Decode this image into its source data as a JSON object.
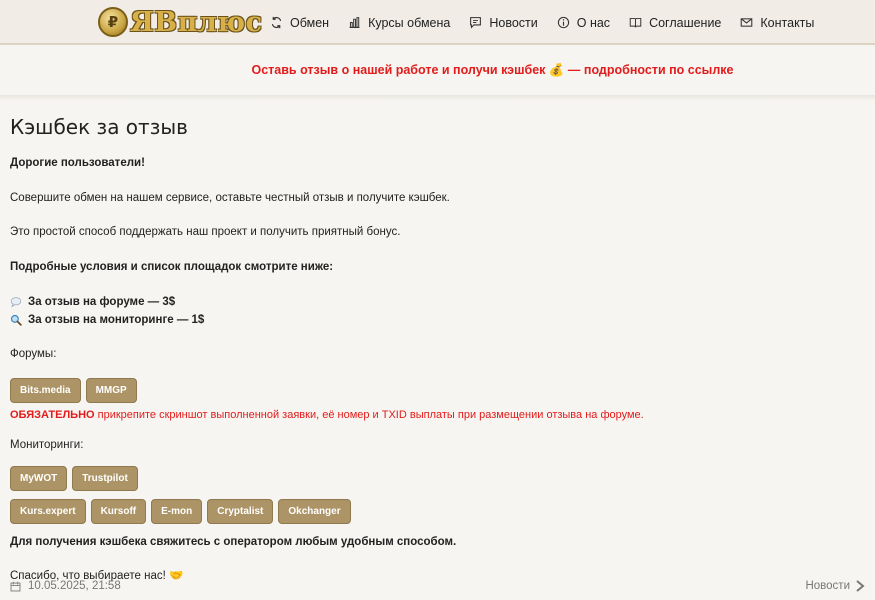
{
  "logo": {
    "text": "ЯВплюс",
    "coin_glyph": "₽"
  },
  "nav": [
    {
      "label": "Обмен",
      "icon": "exchange-icon"
    },
    {
      "label": "Курсы обмена",
      "icon": "chart-icon"
    },
    {
      "label": "Новости",
      "icon": "chat-icon"
    },
    {
      "label": "О нас",
      "icon": "info-icon"
    },
    {
      "label": "Соглашение",
      "icon": "book-icon"
    },
    {
      "label": "Контакты",
      "icon": "mail-icon"
    }
  ],
  "promo": {
    "text": "Оставь отзыв о нашей работе и получи кэшбек 💰 — подробности по ссылке"
  },
  "article": {
    "title": "Кэшбек за отзыв",
    "greeting": "Дорогие пользователи!",
    "p1": "Совершите обмен на нашем сервисе, оставьте честный отзыв и получите кэшбек.",
    "p2": "Это простой способ поддержать наш проект и получить приятный бонус.",
    "conditions": "Подробные условия и список площадок смотрите ниже:",
    "reward_forum": "За отзыв на форуме — 3$",
    "reward_monitoring": "За отзыв на мониторинге — 1$",
    "forums_heading": "Форумы:",
    "forums": [
      "Bits.media",
      "MMGP"
    ],
    "mandatory_bold": "ОБЯЗАТЕЛЬНО",
    "mandatory_rest": " прикрепите скриншот выполненной заявки, её номер и TXID выплаты при размещении отзыва на форуме.",
    "monitoring_heading": "Мониторинги:",
    "monitorings_row1": [
      "MyWOT",
      "Trustpilot"
    ],
    "monitorings_row2": [
      "Kurs.expert",
      "Kursoff",
      "E-mon",
      "Cryptalist",
      "Okchanger"
    ],
    "contact": "Для получения кэшбека свяжитесь с оператором любым удобным способом.",
    "thanks": "Спасибо, что выбираете нас! 🤝"
  },
  "footer": {
    "date": "10.05.2025, 21:58",
    "next_label": "Новости"
  },
  "colors": {
    "accent_red": "#e21b1b",
    "tag_bg": "#ad9466",
    "gold": "#d8b04a"
  }
}
